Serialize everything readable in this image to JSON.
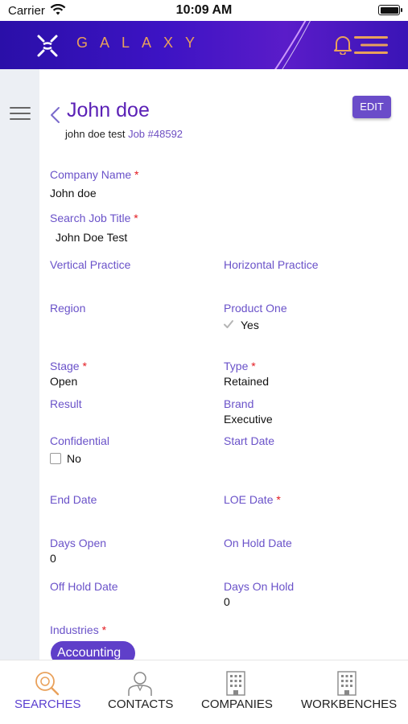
{
  "status_bar": {
    "carrier": "Carrier",
    "time": "10:09 AM"
  },
  "header": {
    "brand": "GALAXY",
    "accent_color": "#e9a15b",
    "background": "#3d13c4"
  },
  "record": {
    "title": "John doe",
    "subtitle_text": "john doe test",
    "job_ref": "Job #48592",
    "edit_label": "EDIT"
  },
  "fields": {
    "company_name": {
      "label": "Company Name",
      "value": "John doe",
      "required": "*"
    },
    "search_job_title": {
      "label": "Search Job Title",
      "value": "John Doe Test",
      "required": "*"
    },
    "vertical_practice": {
      "label": "Vertical Practice"
    },
    "horizontal_practice": {
      "label": "Horizontal Practice"
    },
    "region": {
      "label": "Region"
    },
    "product_one": {
      "label": "Product One",
      "value": "Yes",
      "checked": true
    },
    "stage": {
      "label": "Stage",
      "value": "Open",
      "required": "*"
    },
    "type": {
      "label": "Type",
      "value": "Retained",
      "required": "*"
    },
    "result": {
      "label": "Result"
    },
    "brand": {
      "label": "Brand",
      "value": "Executive"
    },
    "confidential": {
      "label": "Confidential",
      "value": "No",
      "checked": false
    },
    "start_date": {
      "label": "Start Date"
    },
    "end_date": {
      "label": "End Date"
    },
    "loe_date": {
      "label": "LOE Date",
      "required": "*"
    },
    "days_open": {
      "label": "Days Open",
      "value": "0"
    },
    "on_hold_date": {
      "label": "On Hold Date"
    },
    "off_hold_date": {
      "label": "Off Hold Date"
    },
    "days_on_hold": {
      "label": "Days On Hold",
      "value": "0"
    },
    "industries": {
      "label": "Industries",
      "required": "*",
      "chips": [
        "Accounting"
      ]
    }
  },
  "bottom_nav": [
    {
      "label": "SEARCHES",
      "icon": "search-magnifier-icon",
      "active": true
    },
    {
      "label": "CONTACTS",
      "icon": "person-icon",
      "active": false
    },
    {
      "label": "COMPANIES",
      "icon": "building-icon",
      "active": false
    },
    {
      "label": "WORKBENCHES",
      "icon": "building-icon",
      "active": false
    }
  ]
}
